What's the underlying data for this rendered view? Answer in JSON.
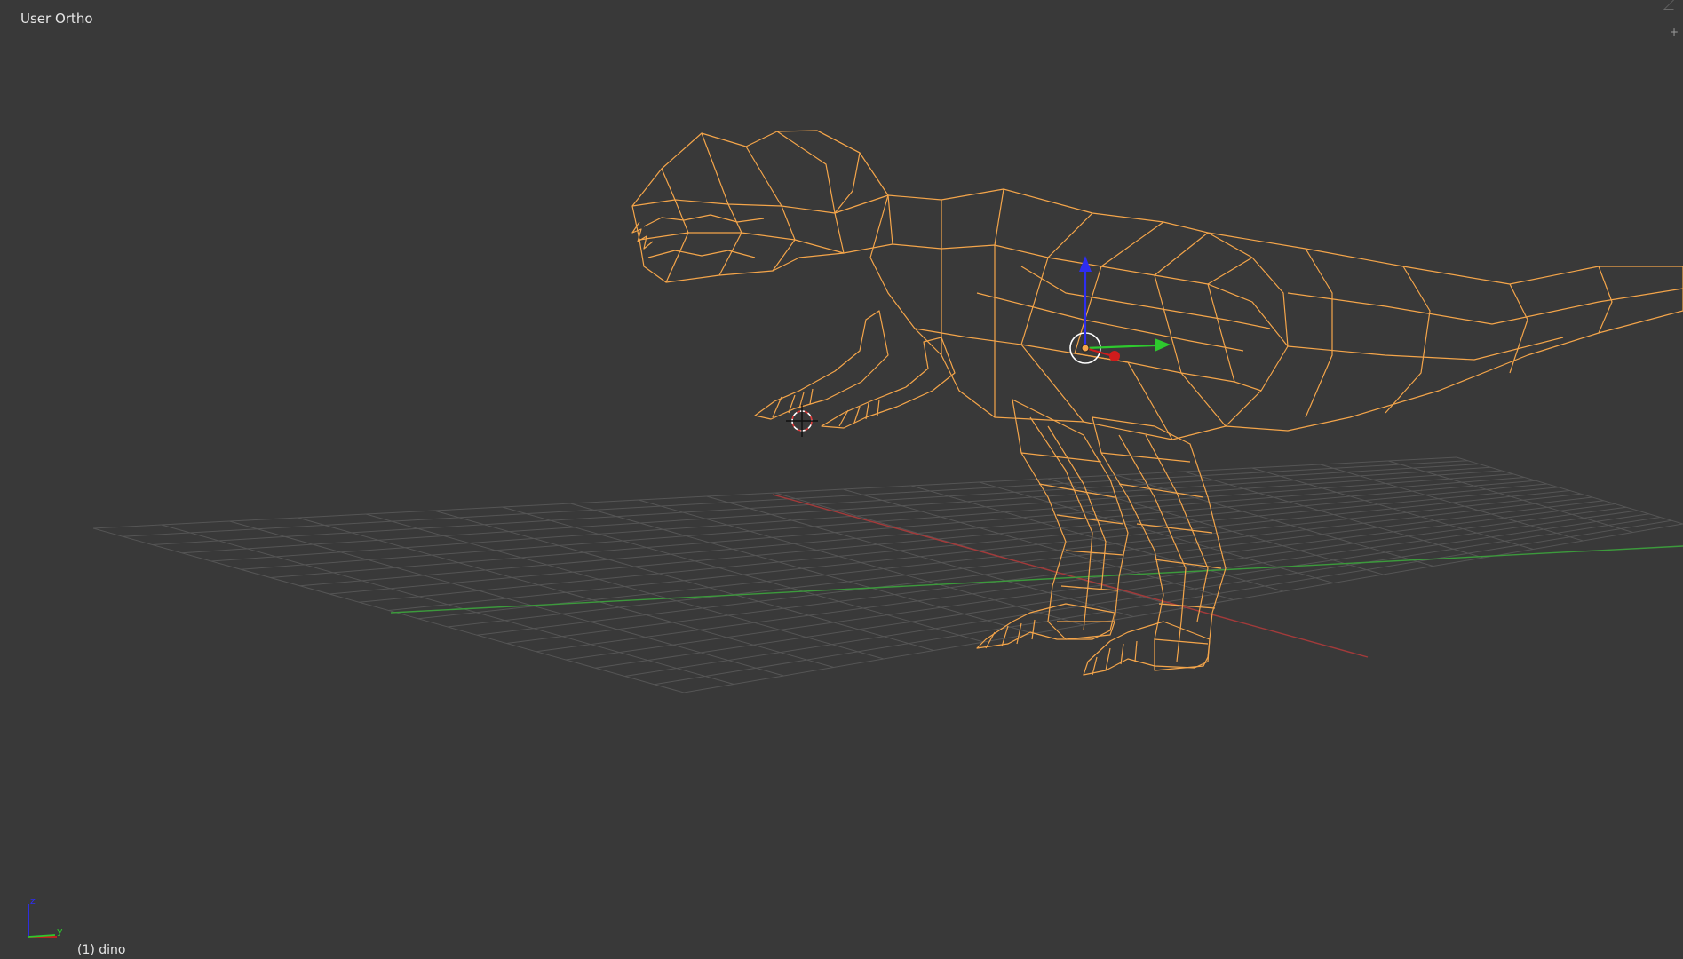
{
  "viewport": {
    "view_label": "User Ortho",
    "object_info": "(1) dino",
    "colors": {
      "background": "#393939",
      "grid": "#555555",
      "x_axis": "#a33a3a",
      "y_axis": "#3c9a3c",
      "wire_selected": "#f4a54a",
      "gizmo_z": "#2d2df0",
      "gizmo_y": "#2ec92e",
      "gizmo_x": "#d01c1c"
    },
    "icons": [
      "3d-cursor-icon",
      "transform-gizmo-icon",
      "axis-orientation-icon",
      "area-split-icon"
    ]
  },
  "axis_gizmo": {
    "z_label": "z",
    "y_label": "y"
  }
}
